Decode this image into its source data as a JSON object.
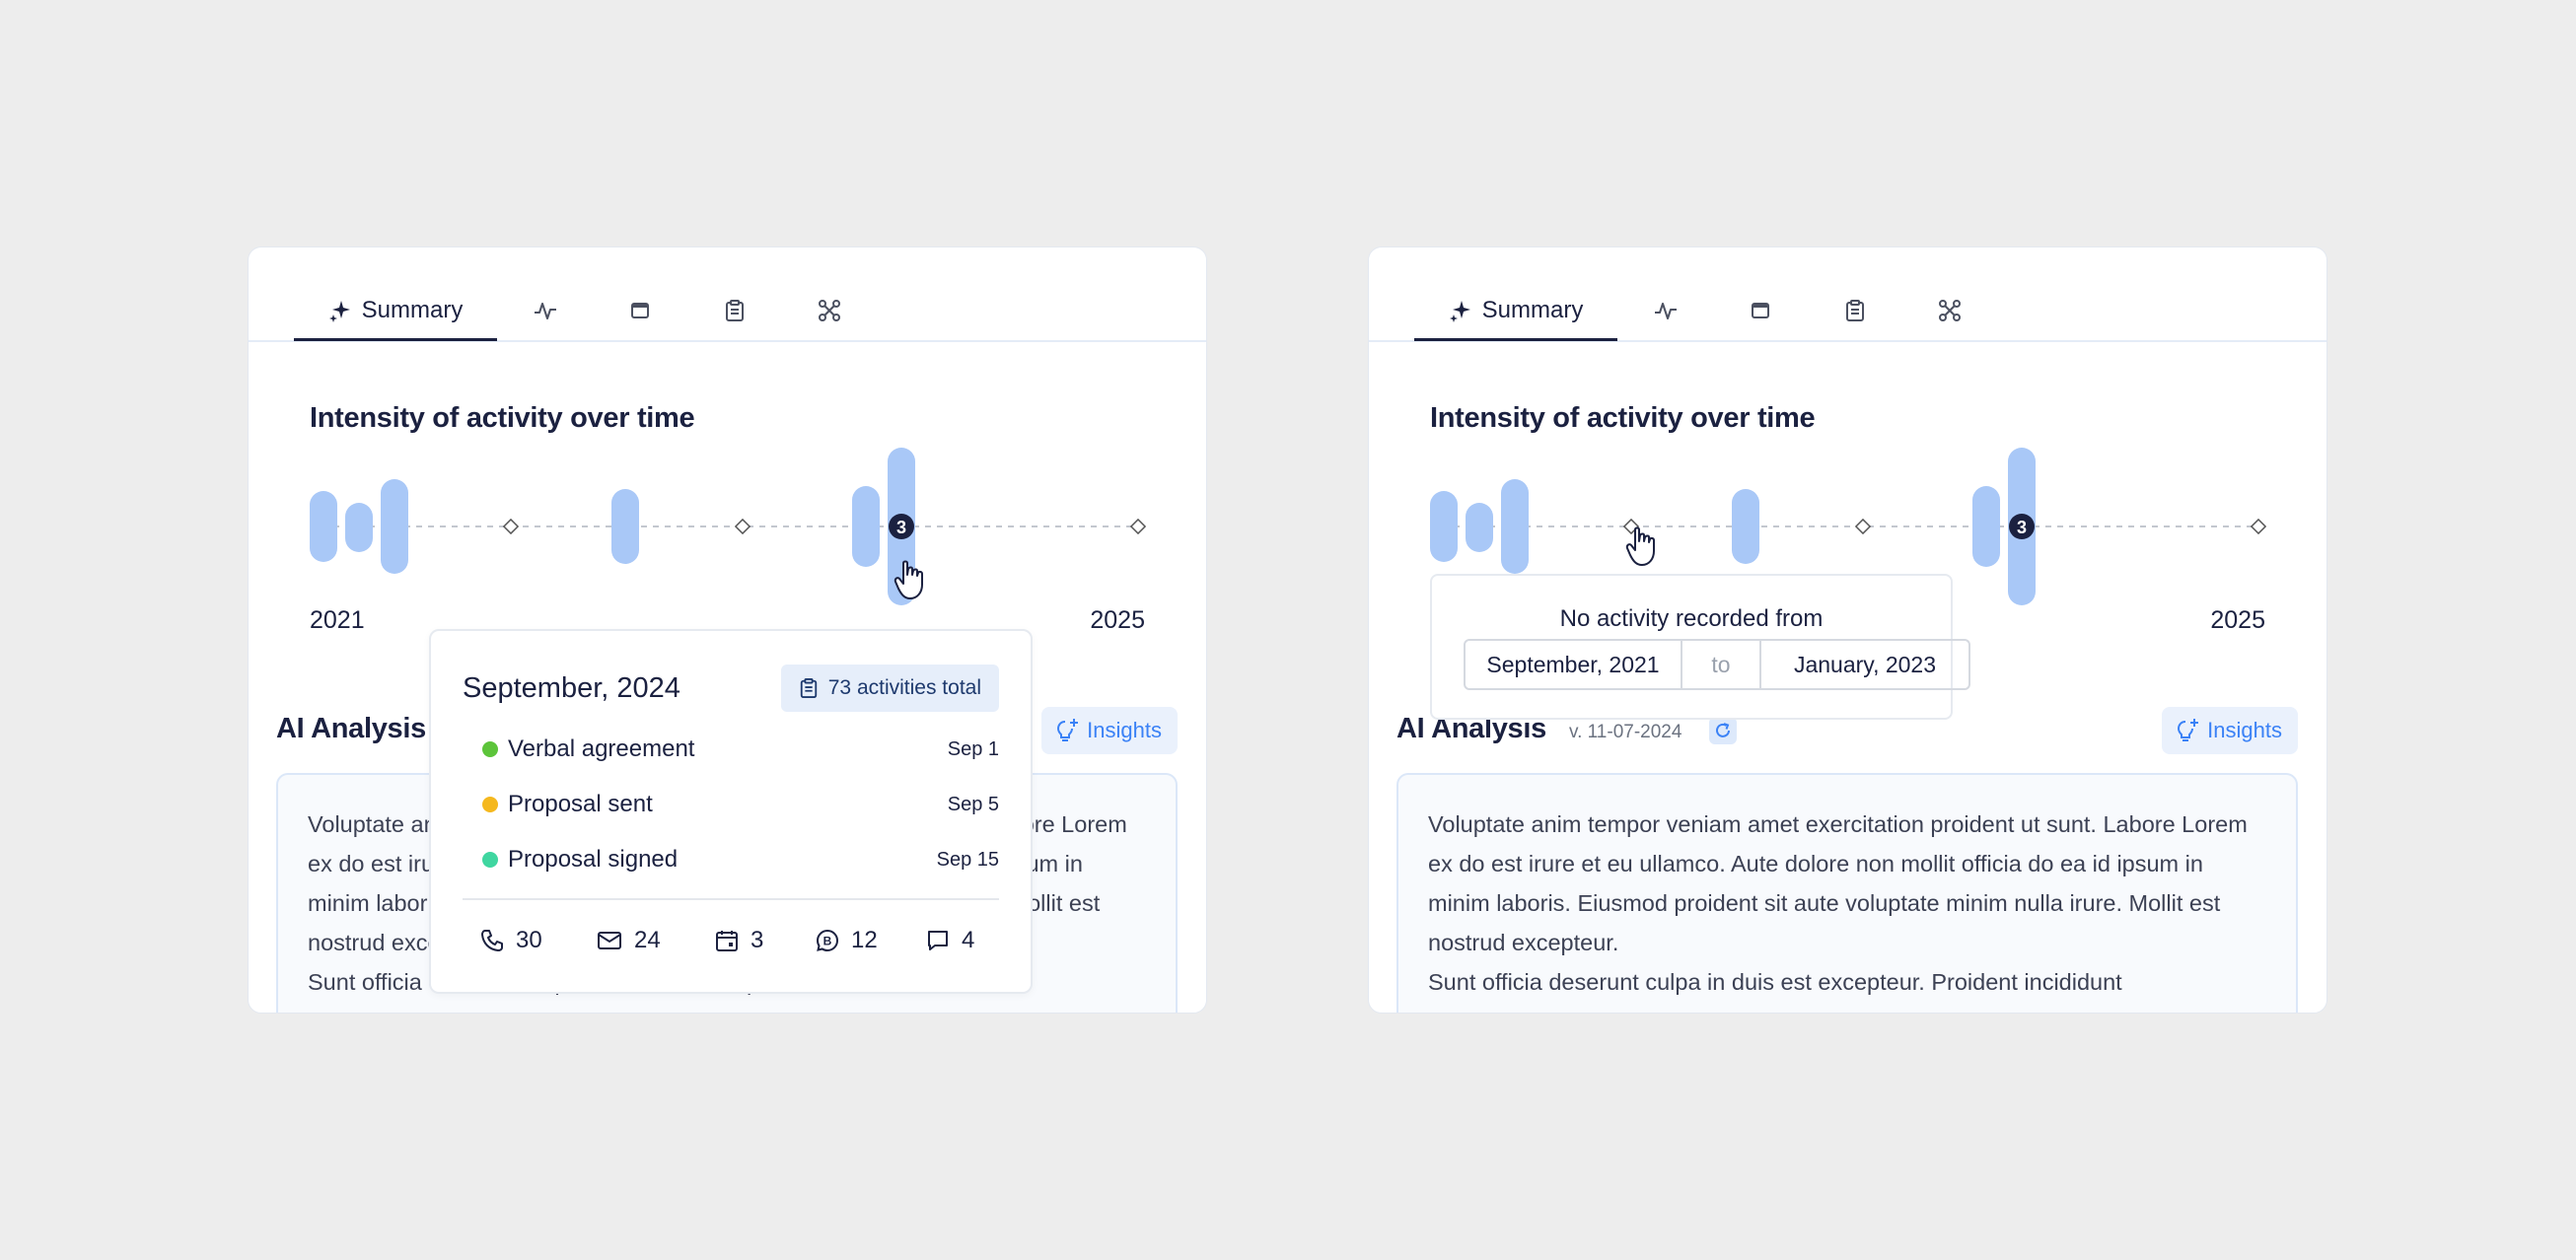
{
  "colors": {
    "bar": "#a9c8f7",
    "accent": "#3b82f6",
    "dark": "#1b2140",
    "green": "#5cc43a",
    "yellow": "#f5b81e",
    "teal": "#3fd6a0"
  },
  "panels": [
    {
      "tabs": {
        "active_label": "Summary",
        "icons": [
          "sparkle-icon",
          "activity-icon",
          "calendar-icon",
          "clipboard-icon",
          "network-icon"
        ]
      },
      "chart": {
        "title": "Intensity of activity over time",
        "start_year": "2021",
        "end_year": "2025",
        "badge_count": "3"
      },
      "ai": {
        "title": "AI Analysis",
        "insights_label": "Insights",
        "paragraphs": [
          "Voluptate anim tempor veniam amet exercitation proident ut sunt. Labore Lorem ex do est irure et eu ullamco. Aute dolore non mollit officia do ea id ipsum in minim laboris. Eiusmod proident sit aute voluptate minim nulla irure. Mollit est nostrud excepteur.",
          "Sunt officia deserunt culpa in duis est excepteur. Proident incididunt"
        ]
      },
      "tooltip": {
        "title": "September, 2024",
        "total": "73 activities total",
        "events": [
          {
            "name": "Verbal agreement",
            "date": "Sep 1",
            "color": "#5cc43a"
          },
          {
            "name": "Proposal sent",
            "date": "Sep 5",
            "color": "#f5b81e"
          },
          {
            "name": "Proposal signed",
            "date": "Sep 15",
            "color": "#3fd6a0"
          }
        ],
        "stats": [
          {
            "icon": "phone-icon",
            "value": "30"
          },
          {
            "icon": "mail-icon",
            "value": "24"
          },
          {
            "icon": "calendar-icon",
            "value": "3"
          },
          {
            "icon": "whatsapp-icon",
            "value": "12"
          },
          {
            "icon": "chat-icon",
            "value": "4"
          }
        ]
      }
    },
    {
      "tabs": {
        "active_label": "Summary",
        "icons": [
          "sparkle-icon",
          "activity-icon",
          "calendar-icon",
          "clipboard-icon",
          "network-icon"
        ]
      },
      "chart": {
        "title": "Intensity of activity over time",
        "end_year": "2025",
        "badge_count": "3"
      },
      "ai": {
        "title": "AI Analysis",
        "version": "v. 11-07-2024",
        "insights_label": "Insights",
        "paragraphs": [
          "Voluptate anim tempor veniam amet exercitation proident ut sunt. Labore Lorem ex do est irure et eu ullamco. Aute dolore non mollit officia do ea id ipsum in minim laboris. Eiusmod proident sit aute voluptate minim nulla irure. Mollit est nostrud excepteur.",
          "Sunt officia deserunt culpa in duis est excepteur. Proident incididunt"
        ]
      },
      "tooltip": {
        "message": "No activity recorded from",
        "from": "September, 2021",
        "to": "to",
        "until": "January, 2023"
      }
    }
  ]
}
